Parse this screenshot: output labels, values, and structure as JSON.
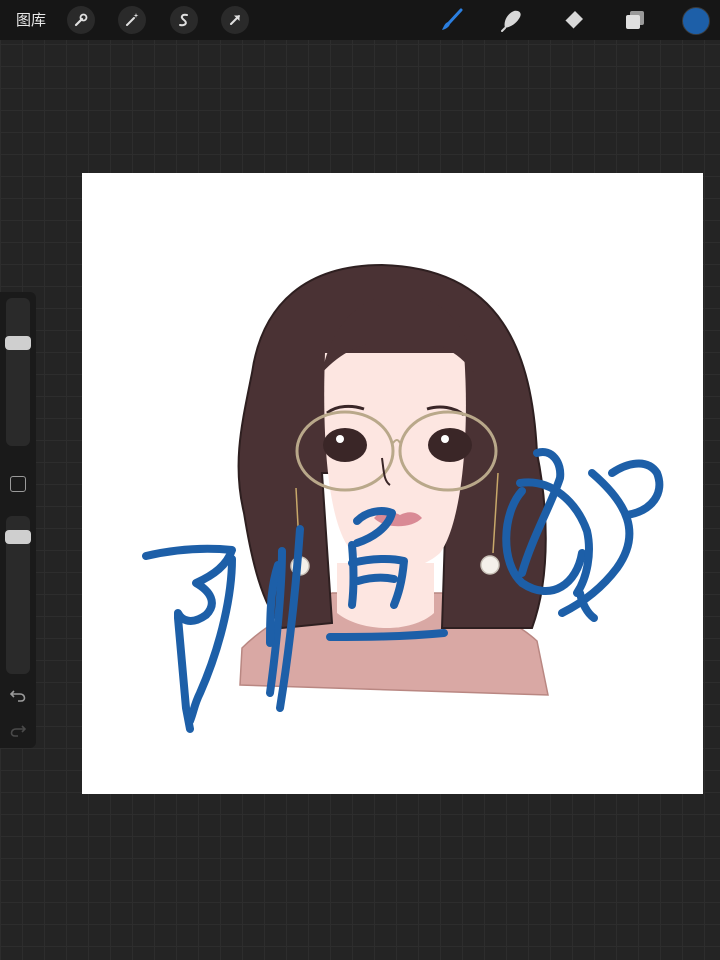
{
  "topbar": {
    "gallery_label": "图库",
    "left_tools": [
      "wrench-icon",
      "magic-wand-icon",
      "selection-icon",
      "transform-arrow-icon"
    ],
    "right_tools": [
      "brush-icon",
      "smudge-icon",
      "eraser-icon",
      "layers-icon"
    ],
    "active_tool": "brush-icon",
    "current_color": "#1d5fa8"
  },
  "sidebar": {
    "brush_size_level": 0.28,
    "brush_opacity_level": 0.1,
    "icons": [
      "modify-square-icon",
      "undo-icon",
      "redo-icon"
    ]
  },
  "canvas": {
    "background": "#ffffff",
    "artwork_colors": {
      "hair": "#4a3234",
      "skin": "#fde6e1",
      "shirt": "#d9a8a4",
      "signature": "#1d5fa8"
    }
  }
}
